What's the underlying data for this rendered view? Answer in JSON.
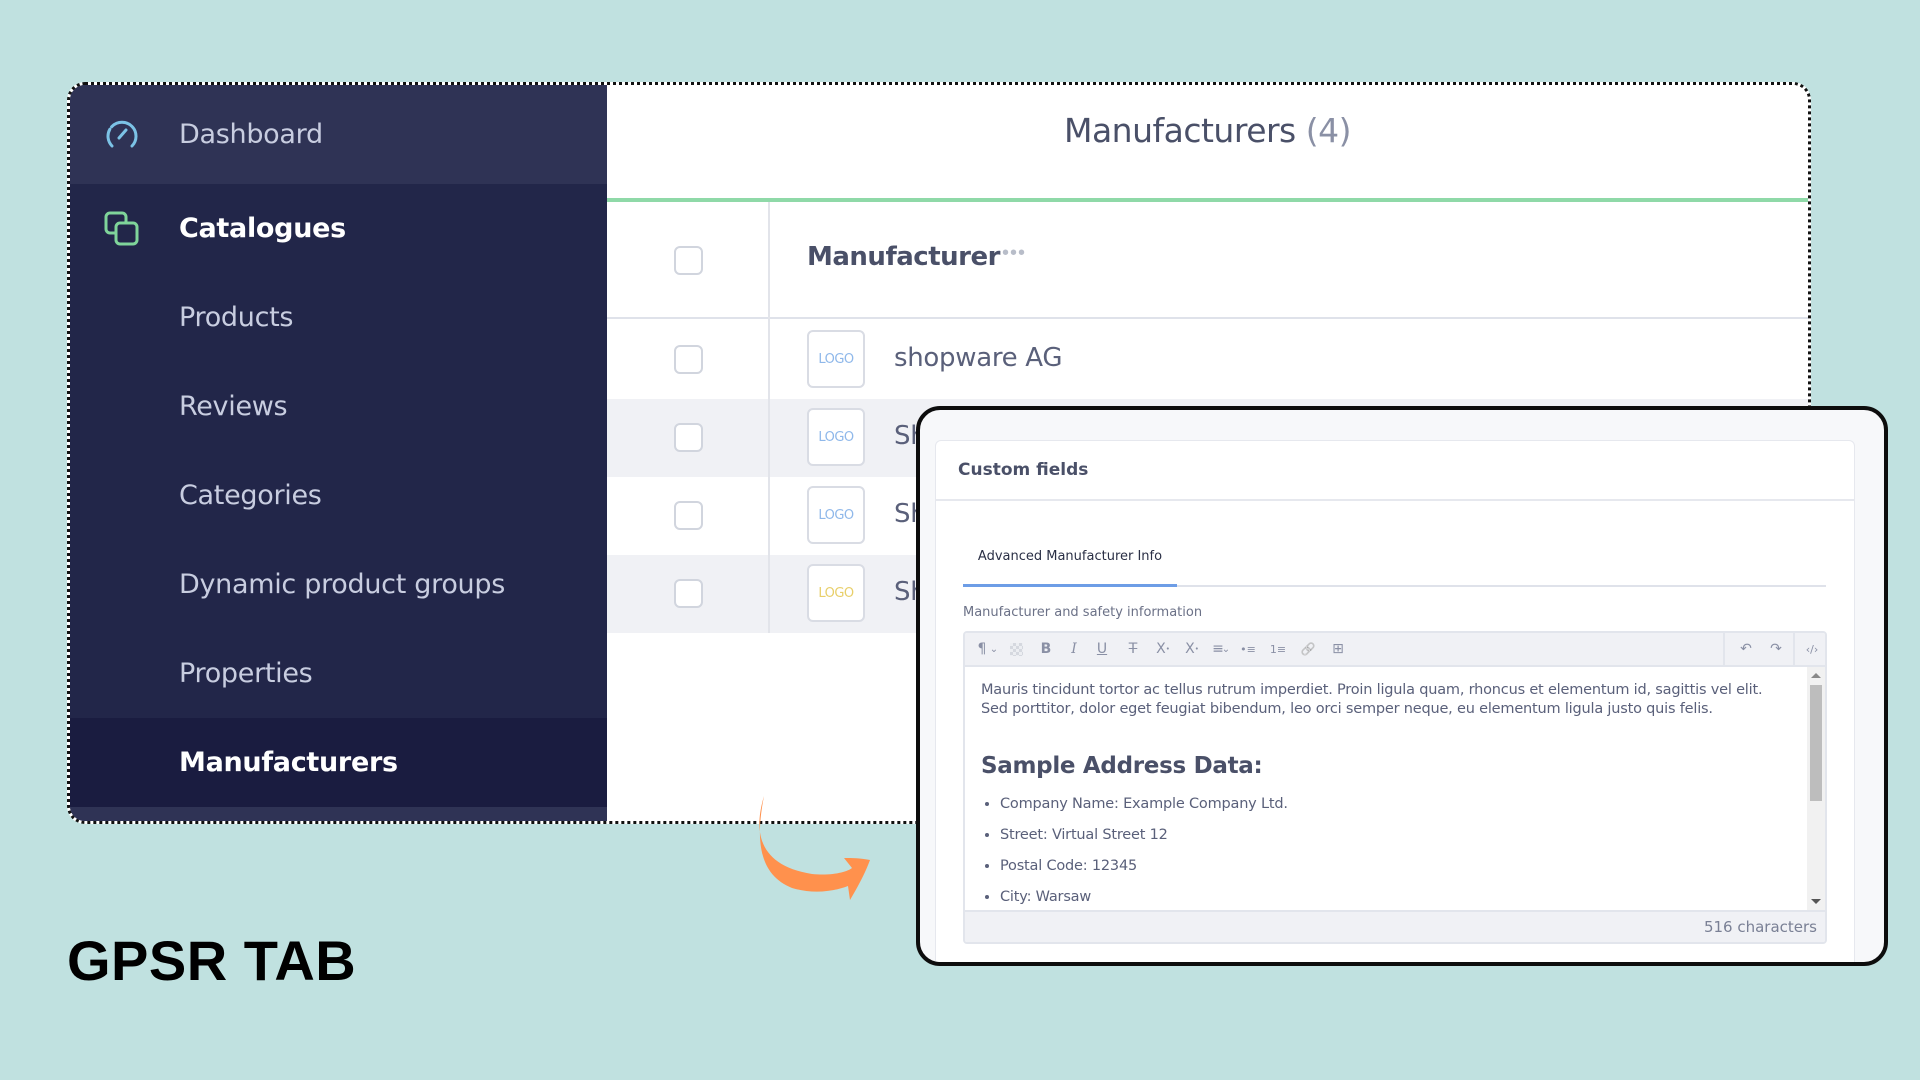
{
  "sidebar": {
    "items": [
      {
        "label": "Dashboard",
        "icon": "speedometer-icon",
        "level": "top"
      },
      {
        "label": "Catalogues",
        "icon": "catalogue-icon",
        "level": "top",
        "expanded": true
      },
      {
        "label": "Products",
        "level": "sub"
      },
      {
        "label": "Reviews",
        "level": "sub"
      },
      {
        "label": "Categories",
        "level": "sub"
      },
      {
        "label": "Dynamic product groups",
        "level": "sub"
      },
      {
        "label": "Properties",
        "level": "sub"
      },
      {
        "label": "Manufacturers",
        "level": "sub",
        "active": true
      }
    ]
  },
  "main": {
    "title": "Manufacturers",
    "count": "(4)",
    "grid": {
      "column_header": "Manufacturer",
      "column_menu": "•••",
      "rows": [
        {
          "logo": "LOGO",
          "logo_color": "#8fb8ea",
          "name": "shopware AG"
        },
        {
          "logo": "LOGO",
          "logo_color": "#8fb8ea",
          "name": "Sh"
        },
        {
          "logo": "LOGO",
          "logo_color": "#8fb8ea",
          "name": "Sh"
        },
        {
          "logo": "LOGO",
          "logo_color": "#e8cf6a",
          "name": "Sh"
        }
      ]
    }
  },
  "custom_fields": {
    "title": "Custom fields",
    "tab": "Advanced Manufacturer Info",
    "field_label": "Manufacturer and safety information",
    "toolbar": {
      "paragraph": "¶",
      "bold": "B",
      "italic": "I",
      "underline": "U",
      "strikethrough": "T",
      "superscript": "X",
      "subscript": "X",
      "align": "≡",
      "bullet_list": "•≡",
      "numbered_list": "1≡",
      "link": "🔗",
      "table": "⊞",
      "undo": "↶",
      "redo": "↷",
      "code": "‹/›"
    },
    "content": {
      "paragraph": "Mauris tincidunt tortor ac tellus rutrum imperdiet. Proin ligula quam, rhoncus et elementum id, sagittis vel elit. Sed porttitor, dolor eget feugiat bibendum, leo orci semper neque, eu elementum ligula justo quis felis.",
      "heading": "Sample Address Data:",
      "list": [
        "Company Name: Example Company Ltd.",
        "Street: Virtual Street 12",
        "Postal Code: 12345",
        "City: Warsaw"
      ]
    },
    "char_count": "516 characters"
  },
  "caption": "GPSR TAB",
  "colors": {
    "background": "#c0e1e0",
    "sidebar": "#222649",
    "accent_green": "#8fd9a8",
    "tab_active": "#6d9de6",
    "arrow": "#ff914d"
  }
}
